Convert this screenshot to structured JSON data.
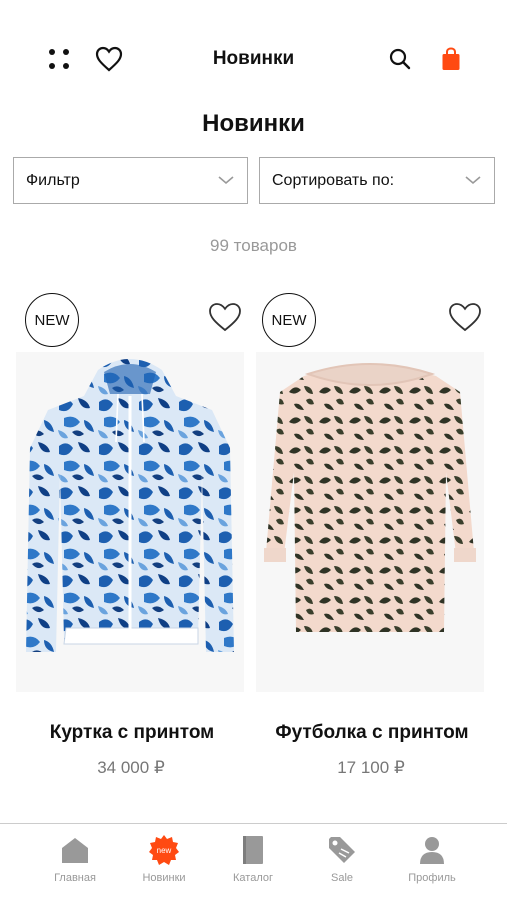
{
  "header": {
    "title": "Новинки",
    "icons": [
      "menu-dots-icon",
      "heart-icon",
      "search-icon",
      "bag-icon"
    ],
    "bag_color": "#ff4a12"
  },
  "page": {
    "title": "Новинки",
    "filter_label": "Фильтр",
    "sort_label": "Сортировать по:",
    "count": "99 товаров"
  },
  "products": [
    {
      "badge": "NEW",
      "name": "Куртка с принтом",
      "price": "34 000 ₽",
      "image": "blue leopard print hooded jacket"
    },
    {
      "badge": "NEW",
      "name": "Футболка с принтом",
      "price": "17 100 ₽",
      "image": "beige long-sleeve top with dark leaf print"
    }
  ],
  "tabbar": {
    "items": [
      {
        "label": "Главная",
        "icon": "home-icon"
      },
      {
        "label": "Новинки",
        "icon": "new-badge-icon",
        "active_color": "#ff4a12"
      },
      {
        "label": "Каталог",
        "icon": "catalog-book-icon"
      },
      {
        "label": "Sale",
        "icon": "sale-tag-icon"
      },
      {
        "label": "Профиль",
        "icon": "profile-icon"
      }
    ]
  }
}
